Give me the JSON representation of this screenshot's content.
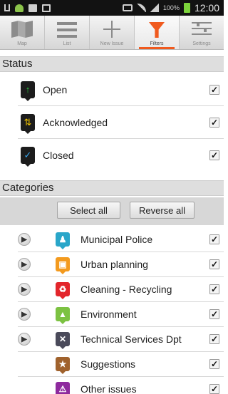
{
  "status_bar": {
    "battery_percent": "100%",
    "time": "12:00"
  },
  "toolbar": {
    "tabs": [
      {
        "label": "Map",
        "icon": "map-icon"
      },
      {
        "label": "List",
        "icon": "list-icon"
      },
      {
        "label": "New Issue",
        "icon": "plus-icon"
      },
      {
        "label": "Filters",
        "icon": "filter-icon",
        "active": true
      },
      {
        "label": "Settings",
        "icon": "settings-icon"
      }
    ],
    "active_color": "#f05a1e"
  },
  "status_section": {
    "title": "Status",
    "items": [
      {
        "label": "Open",
        "icon": "arrow-up-icon",
        "icon_color": "#2ecc40",
        "checked": true
      },
      {
        "label": "Acknowledged",
        "icon": "up-down-arrows-icon",
        "icon_color": "#f2c500",
        "checked": true
      },
      {
        "label": "Closed",
        "icon": "checkmark-icon",
        "icon_color": "#37a8f0",
        "checked": true
      }
    ]
  },
  "categories_section": {
    "title": "Categories",
    "select_all_label": "Select all",
    "reverse_all_label": "Reverse all",
    "items": [
      {
        "label": "Municipal Police",
        "icon": "police-officer-icon",
        "color": "#2aa6c9",
        "expandable": true,
        "checked": true
      },
      {
        "label": "Urban planning",
        "icon": "buildings-icon",
        "color": "#f39a1e",
        "expandable": true,
        "checked": true
      },
      {
        "label": "Cleaning - Recycling",
        "icon": "recycle-icon",
        "color": "#e3262b",
        "expandable": true,
        "checked": true
      },
      {
        "label": "Environment",
        "icon": "trees-icon",
        "color": "#7cc242",
        "expandable": true,
        "checked": true
      },
      {
        "label": "Technical Services Dpt",
        "icon": "tools-icon",
        "color": "#4a4a5a",
        "expandable": true,
        "checked": true
      },
      {
        "label": "Suggestions",
        "icon": "star-icon",
        "color": "#a0622d",
        "expandable": false,
        "checked": true
      },
      {
        "label": "Other issues",
        "icon": "warning-icon",
        "color": "#8e2a9e",
        "expandable": false,
        "checked": true
      }
    ]
  }
}
